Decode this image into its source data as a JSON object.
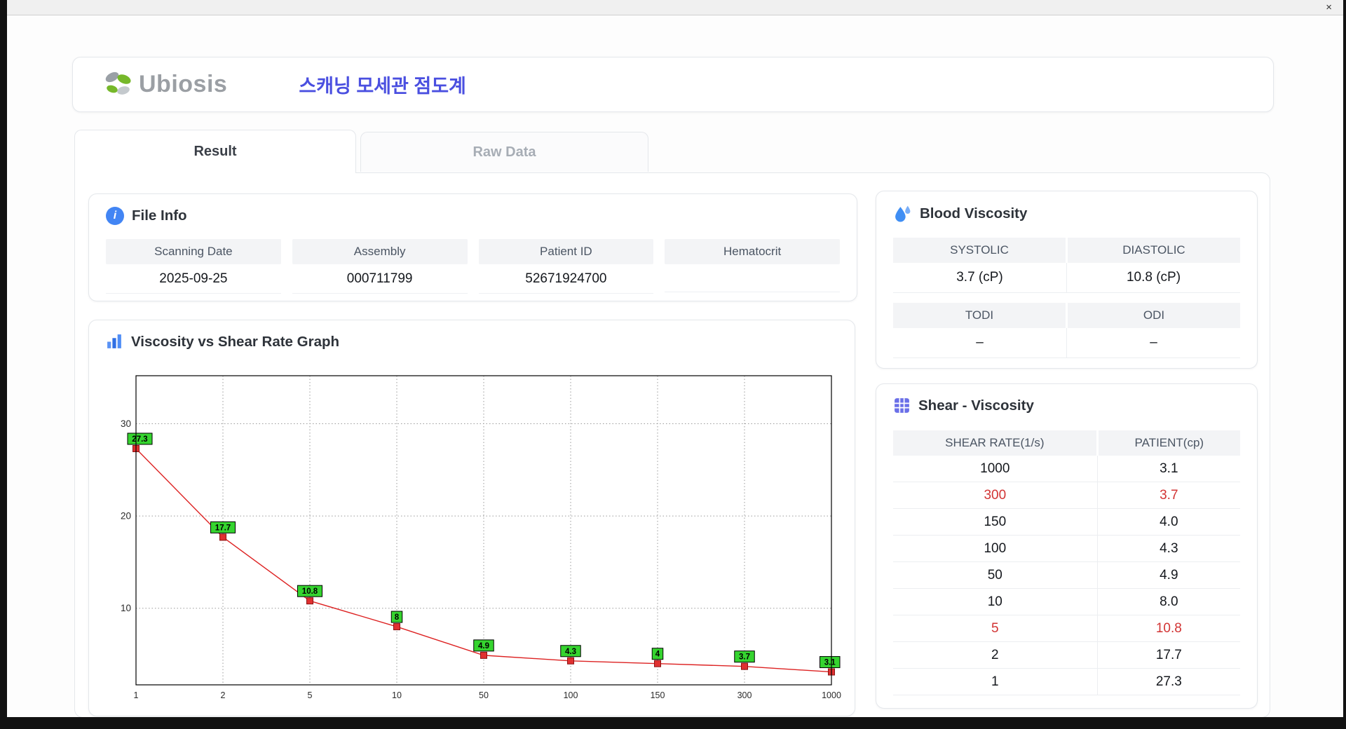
{
  "window": {
    "close": "×"
  },
  "header": {
    "logo": "Ubiosis",
    "title": "스캐닝 모세관 점도계"
  },
  "tabs": [
    {
      "label": "Result"
    },
    {
      "label": "Raw Data"
    }
  ],
  "file_info": {
    "title": "File Info",
    "fields": [
      {
        "label": "Scanning Date",
        "value": "2025-09-25"
      },
      {
        "label": "Assembly",
        "value": "000711799"
      },
      {
        "label": "Patient ID",
        "value": "52671924700"
      },
      {
        "label": "Hematocrit",
        "value": ""
      }
    ]
  },
  "blood_viscosity": {
    "title": "Blood Viscosity",
    "sections": [
      {
        "headers": [
          "SYSTOLIC",
          "DIASTOLIC"
        ],
        "values": [
          "3.7 (cP)",
          "10.8 (cP)"
        ]
      },
      {
        "headers": [
          "TODI",
          "ODI"
        ],
        "values": [
          "–",
          "–"
        ]
      }
    ]
  },
  "shear_viscosity": {
    "title": "Shear - Viscosity",
    "columns": [
      "SHEAR RATE(1/s)",
      "PATIENT(cp)"
    ],
    "rows": [
      {
        "shear": "1000",
        "patient": "3.1",
        "highlight": false
      },
      {
        "shear": "300",
        "patient": "3.7",
        "highlight": true
      },
      {
        "shear": "150",
        "patient": "4.0",
        "highlight": false
      },
      {
        "shear": "100",
        "patient": "4.3",
        "highlight": false
      },
      {
        "shear": "50",
        "patient": "4.9",
        "highlight": false
      },
      {
        "shear": "10",
        "patient": "8.0",
        "highlight": false
      },
      {
        "shear": "5",
        "patient": "10.8",
        "highlight": true
      },
      {
        "shear": "2",
        "patient": "17.7",
        "highlight": false
      },
      {
        "shear": "1",
        "patient": "27.3",
        "highlight": false
      }
    ]
  },
  "chart_data": {
    "type": "line",
    "title": "Viscosity vs Shear Rate Graph",
    "xlabel": "",
    "ylabel": "",
    "categories": [
      "1",
      "2",
      "5",
      "10",
      "50",
      "100",
      "150",
      "300",
      "1000"
    ],
    "values": [
      27.3,
      17.7,
      10.8,
      8,
      4.9,
      4.3,
      4,
      3.7,
      3.1
    ],
    "point_labels": [
      "27.3",
      "17.7",
      "10.8",
      "8",
      "4.9",
      "4.3",
      "4",
      "3.7",
      "3.1"
    ],
    "yticks": [
      10,
      20,
      30
    ],
    "ylim": [
      1.7,
      35.2
    ],
    "grid": true,
    "legend": false,
    "line_color": "#dd2222",
    "marker_color": "#e03030",
    "marker_edge": "#8a1212",
    "label_bg": "#35d42f",
    "label_border": "#000000"
  }
}
